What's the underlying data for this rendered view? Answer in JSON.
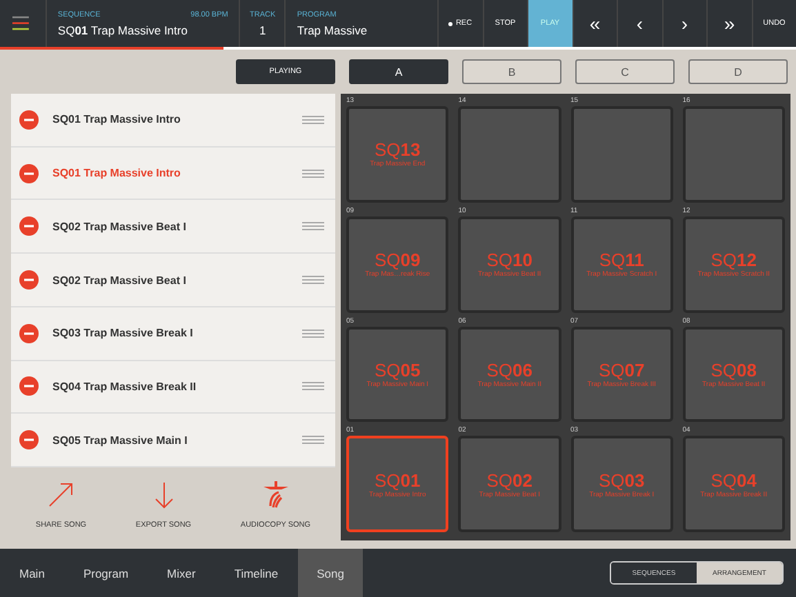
{
  "header": {
    "sequence_label": "SEQUENCE",
    "sequence": "SQ**01** Trap Massive Intro",
    "bpm": "98.00 BPM",
    "track_label": "TRACK",
    "track": "1",
    "program_label": "PROGRAM",
    "program": "Trap Massive",
    "progress": {
      "level": 0.28
    }
  },
  "transport": [
    {
      "kind": "rec",
      "label": "REC",
      "selected": false
    },
    {
      "kind": "text",
      "label": "STOP",
      "selected": false
    },
    {
      "kind": "text",
      "label": "PLAY",
      "selected": true
    },
    {
      "kind": "text",
      "label": "«",
      "selected": false
    },
    {
      "kind": "text",
      "label": "‹",
      "selected": false
    },
    {
      "kind": "text",
      "label": "›",
      "selected": false
    },
    {
      "kind": "text",
      "label": "»",
      "selected": false
    },
    {
      "kind": "text",
      "label": "UNDO",
      "selected": false
    }
  ],
  "playing_label": "PLAYING",
  "banks": [
    {
      "label": "A",
      "selected": true
    },
    {
      "label": "B",
      "selected": false
    },
    {
      "label": "C",
      "selected": false
    },
    {
      "label": "D",
      "selected": false
    }
  ],
  "song_list": [
    {
      "name": "SQ01 Trap Massive Intro",
      "selected": false
    },
    {
      "name": "SQ01 Trap Massive Intro",
      "selected": true
    },
    {
      "name": "SQ02 Trap Massive Beat I",
      "selected": false
    },
    {
      "name": "SQ02 Trap Massive Beat I",
      "selected": false
    },
    {
      "name": "SQ03 Trap Massive Break I",
      "selected": false
    },
    {
      "name": "SQ04 Trap Massive Break II",
      "selected": false
    },
    {
      "name": "SQ05 Trap Massive Main I",
      "selected": false
    }
  ],
  "song_actions": [
    {
      "kind": "share",
      "label": "SHARE SONG"
    },
    {
      "kind": "export",
      "label": "EXPORT SONG"
    },
    {
      "kind": "audiocopy",
      "label": "AUDIOCOPY SONG"
    }
  ],
  "pads": [
    {
      "number": "13",
      "code": "SQ**13**",
      "name": "Trap Massive End",
      "selected": false
    },
    {
      "number": "14",
      "selected": false
    },
    {
      "number": "15",
      "selected": false
    },
    {
      "number": "16",
      "selected": false
    },
    {
      "number": "09",
      "code": "SQ**09**",
      "name": "Trap Mas…reak Rise",
      "selected": false
    },
    {
      "number": "10",
      "code": "SQ**10**",
      "name": "Trap Massive Beat II",
      "selected": false
    },
    {
      "number": "11",
      "code": "SQ**11**",
      "name": "Trap Massive Scratch I",
      "selected": false
    },
    {
      "number": "12",
      "code": "SQ**12**",
      "name": "Trap Massive Scratch II",
      "selected": false
    },
    {
      "number": "05",
      "code": "SQ**05**",
      "name": "Trap Massive Main I",
      "selected": false
    },
    {
      "number": "06",
      "code": "SQ**06**",
      "name": "Trap Massive Main II",
      "selected": false
    },
    {
      "number": "07",
      "code": "SQ**07**",
      "name": "Trap Massive Break III",
      "selected": false
    },
    {
      "number": "08",
      "code": "SQ**08**",
      "name": "Trap Massive Beat II",
      "selected": false
    },
    {
      "number": "01",
      "code": "SQ**01**",
      "name": "Trap Massive Intro",
      "selected": true
    },
    {
      "number": "02",
      "code": "SQ**02**",
      "name": "Trap Massive Beat I",
      "selected": false
    },
    {
      "number": "03",
      "code": "SQ**03**",
      "name": "Trap Massive Break I",
      "selected": false
    },
    {
      "number": "04",
      "code": "SQ**04**",
      "name": "Trap Massive Break II",
      "selected": false
    }
  ],
  "tabs": [
    {
      "label": "Main",
      "selected": false
    },
    {
      "label": "Program",
      "selected": false
    },
    {
      "label": "Mixer",
      "selected": false
    },
    {
      "label": "Timeline",
      "selected": false
    },
    {
      "label": "Song",
      "selected": true
    }
  ],
  "view_toggle": [
    {
      "label": "SEQUENCES",
      "selected": false
    },
    {
      "label": "ARRANGEMENT",
      "selected": true
    }
  ]
}
